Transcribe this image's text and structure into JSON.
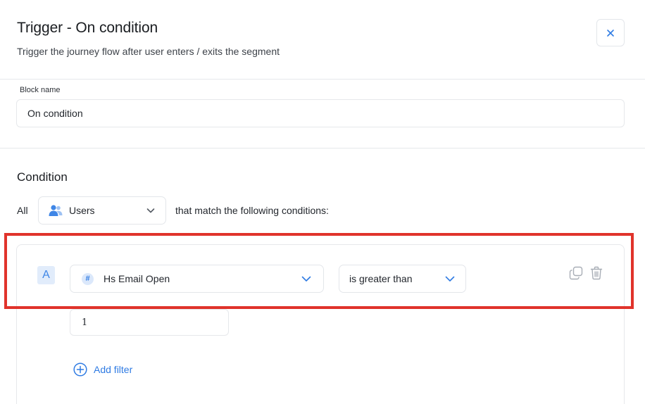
{
  "header": {
    "title": "Trigger - On condition",
    "subtitle": "Trigger the journey flow after user enters / exits the segment",
    "close_icon": "close-icon"
  },
  "block_name": {
    "label": "Block name",
    "value": "On condition"
  },
  "condition": {
    "heading": "Condition",
    "all_label": "All",
    "audience": {
      "selected": "Users",
      "icon": "users-icon"
    },
    "match_text": "that match the following conditions:",
    "rule": {
      "badge": "A",
      "field": {
        "icon": "hash-icon",
        "selected": "Hs Email Open"
      },
      "operator": {
        "selected": "is greater than"
      },
      "value": "1"
    },
    "add_filter_label": "Add filter"
  },
  "colors": {
    "accent": "#2f7be3",
    "highlight": "#e0332b",
    "border": "#e6e8eb"
  }
}
